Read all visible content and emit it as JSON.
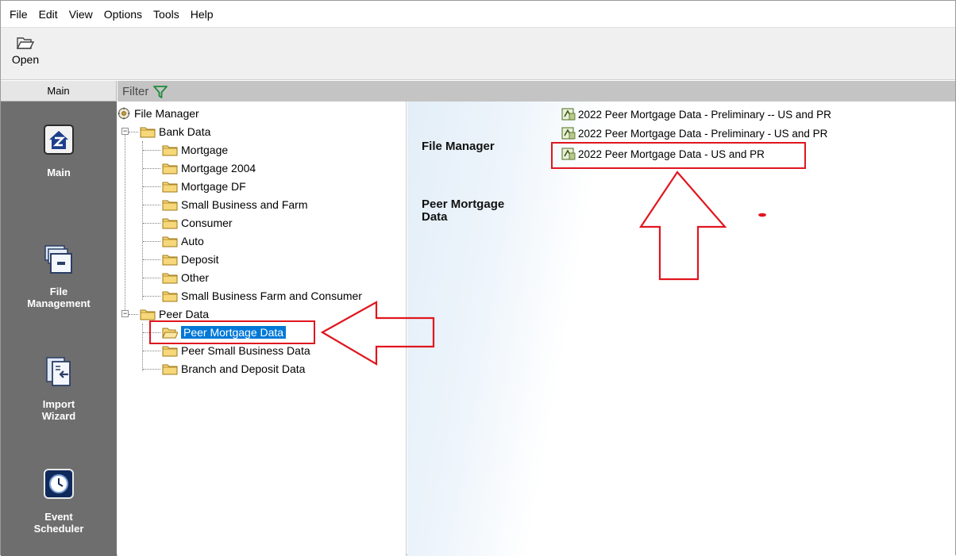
{
  "menu": [
    "File",
    "Edit",
    "View",
    "Options",
    "Tools",
    "Help"
  ],
  "toolbar": {
    "open_label": "Open"
  },
  "nav": {
    "tab_label": "Main",
    "items": [
      {
        "label": "Main",
        "icon": "house-icon"
      },
      {
        "label": "File Management",
        "icon": "file-cabinet-icon"
      },
      {
        "label": "Import Wizard",
        "icon": "import-icon"
      },
      {
        "label": "Event Scheduler",
        "icon": "clock-icon"
      }
    ]
  },
  "filter": {
    "label": "Filter"
  },
  "tree": {
    "root": "File Manager",
    "groups": [
      {
        "label": "Bank Data",
        "expander": "−",
        "children": [
          "Mortgage",
          "Mortgage 2004",
          "Mortgage DF",
          "Small Business and Farm",
          "Consumer",
          "Auto",
          "Deposit",
          "Other",
          "Small Business Farm and Consumer"
        ]
      },
      {
        "label": "Peer Data",
        "expander": "−",
        "children": [
          "Peer Mortgage Data",
          "Peer Small Business Data",
          "Branch and Deposit Data"
        ]
      }
    ],
    "selected": "Peer Mortgage Data"
  },
  "right_pane": {
    "heading": "File Manager",
    "subheading": "Peer Mortgage Data",
    "files": [
      "2022 Peer Mortgage Data - Preliminary -- US and PR",
      "2022 Peer Mortgage Data - Preliminary - US and PR",
      "2022 Peer Mortgage Data - US and PR"
    ],
    "highlighted_file_index": 2
  },
  "colors": {
    "annotation_red": "#e0161e",
    "selection_blue": "#0078d7",
    "nav_panel": "#6e6e6e",
    "filter_bar": "#c4c4c4"
  }
}
